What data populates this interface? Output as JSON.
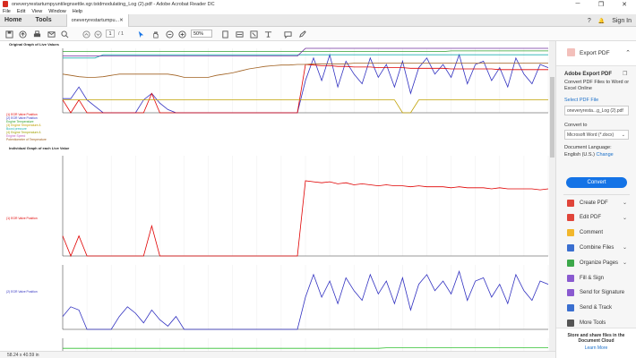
{
  "window": {
    "title": "oneveryrestartumpyuntilegnsettle.xgr.tstdmodulating_Log (2).pdf - Adobe Acrobat Reader DC",
    "minimize": "─",
    "maximize": "❐",
    "close": "✕"
  },
  "menu": [
    "File",
    "Edit",
    "View",
    "Window",
    "Help"
  ],
  "tabs": {
    "home": "Home",
    "tools": "Tools",
    "doc_tab": "oneveryrestartumpu...",
    "doc_tab_close": "✕",
    "help_icon": "?",
    "bell_icon": "🔔",
    "sign_in": "Sign In"
  },
  "toolbar": {
    "page_current": "1",
    "page_total": "/ 1",
    "zoom": "50%"
  },
  "document": {
    "heading1": "Original Graph of Live Values",
    "heading2": "Individual Graph of each Live Value",
    "legend1": [
      {
        "text": "(1) EGR Valve Position",
        "color": "#e00000"
      },
      {
        "text": "(2) EGR Valve Position",
        "color": "#3030c0"
      },
      {
        "text": "Engine Temperature",
        "color": "#30a030"
      },
      {
        "text": "(3) Engine Temperature A",
        "color": "#c0a000"
      },
      {
        "text": "Boost pressure",
        "color": "#20b0b0"
      },
      {
        "text": "(4) Engine Temperature A",
        "color": "#a0a000"
      },
      {
        "text": "Engine Speed",
        "color": "#c060c0"
      },
      {
        "text": "Potentiometer of Temperature",
        "color": "#a06020"
      }
    ],
    "label_red": "(1) EGR Valve Position",
    "label_blue": "(2) EGR Valve Position"
  },
  "status": {
    "size": "58.24 x 40.59 in"
  },
  "right_pane": {
    "header": "Export PDF",
    "section_title": "Adobe Export PDF",
    "desc": "Convert PDF Files to Word or Excel Online",
    "select_label": "Select PDF File",
    "file_value": "oneveryresta...g_Log (2).pdf",
    "convert_to": "Convert to",
    "format": "Microsoft Word (*.docx)",
    "lang_label": "Document Language:",
    "lang_value": "English (U.S.)",
    "change": "Change",
    "convert_btn": "Convert",
    "tools": [
      {
        "label": "Create PDF",
        "color": "#e0453a",
        "chev": "⌄"
      },
      {
        "label": "Edit PDF",
        "color": "#e0453a",
        "chev": "⌄"
      },
      {
        "label": "Comment",
        "color": "#f2b72c",
        "chev": ""
      },
      {
        "label": "Combine Files",
        "color": "#3a6fd0",
        "chev": "⌄"
      },
      {
        "label": "Organize Pages",
        "color": "#3ca84a",
        "chev": "⌄"
      },
      {
        "label": "Fill & Sign",
        "color": "#8a5ad0",
        "chev": ""
      },
      {
        "label": "Send for Signature",
        "color": "#8a5ad0",
        "chev": ""
      },
      {
        "label": "Send & Track",
        "color": "#3a6fd0",
        "chev": ""
      },
      {
        "label": "More Tools",
        "color": "#555555",
        "chev": ""
      }
    ],
    "foot_text": "Store and share files in the Document Cloud",
    "learn_more": "Learn More"
  },
  "chart_data": [
    {
      "type": "line",
      "title": "Original Graph of Live Values",
      "x": [
        0,
        1,
        2,
        3,
        4,
        5,
        6,
        7,
        8,
        9,
        10,
        11,
        12,
        13,
        14,
        15,
        16,
        17,
        18,
        19,
        20,
        21,
        22,
        23,
        24,
        25,
        26,
        27,
        28,
        29,
        30,
        31,
        32,
        33,
        34,
        35,
        36,
        37,
        38,
        39,
        40,
        41,
        42,
        43,
        44,
        45,
        46,
        47,
        48,
        49,
        50,
        51,
        52,
        53,
        54,
        55,
        56,
        57,
        58,
        59,
        60
      ],
      "series": [
        {
          "color": "#3030c0",
          "values": [
            22,
            22,
            40,
            20,
            10,
            0,
            0,
            0,
            0,
            0,
            20,
            30,
            15,
            5,
            0,
            0,
            0,
            0,
            0,
            0,
            0,
            0,
            0,
            0,
            0,
            0,
            0,
            0,
            0,
            0,
            50,
            85,
            50,
            90,
            40,
            80,
            60,
            45,
            85,
            55,
            75,
            40,
            80,
            30,
            70,
            85,
            60,
            75,
            55,
            90,
            45,
            75,
            80,
            50,
            70,
            40,
            85,
            60,
            45,
            75,
            70
          ]
        },
        {
          "color": "#e00000",
          "values": [
            20,
            0,
            20,
            0,
            0,
            0,
            0,
            0,
            0,
            0,
            0,
            30,
            0,
            0,
            0,
            0,
            0,
            0,
            0,
            0,
            0,
            0,
            0,
            0,
            0,
            0,
            0,
            0,
            0,
            0,
            75,
            74,
            73,
            73,
            72,
            72,
            71,
            71,
            71,
            70,
            70,
            70,
            70,
            69,
            69,
            69,
            69,
            69,
            68,
            68,
            68,
            68,
            68,
            68,
            67,
            67,
            67,
            67,
            67,
            67,
            67
          ]
        },
        {
          "color": "#a06020",
          "values": [
            60,
            58,
            56,
            55,
            55,
            56,
            58,
            60,
            60,
            60,
            60,
            60,
            60,
            60,
            58,
            55,
            55,
            55,
            55,
            58,
            60,
            62,
            65,
            68,
            70,
            72,
            73,
            74,
            74,
            75,
            75,
            76,
            76,
            76,
            76,
            76,
            77,
            77,
            77,
            77,
            77,
            77,
            77,
            77,
            77,
            77,
            77,
            77,
            77,
            77,
            77,
            77,
            77,
            77,
            77,
            77,
            77,
            77,
            77,
            77,
            77
          ]
        },
        {
          "color": "#20b0b0",
          "values": [
            85,
            85,
            85,
            85,
            85,
            90,
            90,
            90,
            90,
            90,
            90,
            90,
            90,
            90,
            90,
            90,
            90,
            90,
            90,
            90,
            90,
            90,
            90,
            90,
            90,
            90,
            90,
            90,
            90,
            90,
            90,
            90,
            90,
            90,
            90,
            90,
            90,
            90,
            90,
            90,
            90,
            90,
            90,
            90,
            90,
            90,
            90,
            90,
            90,
            90,
            90,
            90,
            90,
            90,
            90,
            90,
            90,
            90,
            90,
            90,
            90
          ]
        },
        {
          "color": "#30a030",
          "values": [
            95,
            95,
            95,
            95,
            95,
            95,
            95,
            95,
            95,
            95,
            95,
            95,
            95,
            95,
            95,
            95,
            95,
            95,
            95,
            95,
            95,
            95,
            95,
            95,
            95,
            95,
            95,
            95,
            95,
            95,
            95,
            95,
            95,
            95,
            95,
            95,
            95,
            95,
            95,
            95,
            95,
            95,
            95,
            95,
            95,
            95,
            95,
            95,
            96,
            96,
            96,
            96,
            96,
            96,
            96,
            96,
            96,
            96,
            96,
            96,
            96
          ]
        },
        {
          "color": "#c0a000",
          "values": [
            20,
            20,
            20,
            20,
            20,
            20,
            20,
            20,
            20,
            20,
            20,
            20,
            20,
            20,
            20,
            20,
            20,
            20,
            20,
            20,
            20,
            20,
            20,
            20,
            20,
            20,
            20,
            20,
            20,
            20,
            20,
            20,
            20,
            20,
            20,
            20,
            20,
            20,
            20,
            20,
            20,
            20,
            0,
            0,
            20,
            20,
            20,
            20,
            20,
            20,
            20,
            20,
            20,
            20,
            20,
            20,
            20,
            20,
            20,
            20,
            20
          ]
        },
        {
          "color": "#7030a0",
          "values": [
            88,
            88,
            88,
            88,
            88,
            88,
            88,
            88,
            88,
            88,
            88,
            88,
            88,
            88,
            88,
            88,
            88,
            88,
            88,
            88,
            88,
            88,
            88,
            88,
            88,
            88,
            88,
            88,
            88,
            88,
            100,
            100,
            100,
            100,
            100,
            100,
            100,
            100,
            100,
            100,
            100,
            100,
            100,
            100,
            100,
            100,
            100,
            100,
            100,
            100,
            100,
            100,
            100,
            100,
            100,
            100,
            100,
            100,
            100,
            100,
            100
          ]
        }
      ]
    },
    {
      "type": "line",
      "x": [
        0,
        1,
        2,
        3,
        4,
        5,
        6,
        7,
        8,
        9,
        10,
        11,
        12,
        13,
        14,
        15,
        16,
        17,
        18,
        19,
        20,
        21,
        22,
        23,
        24,
        25,
        26,
        27,
        28,
        29,
        30,
        31,
        32,
        33,
        34,
        35,
        36,
        37,
        38,
        39,
        40,
        41,
        42,
        43,
        44,
        45,
        46,
        47,
        48,
        49,
        50,
        51,
        52,
        53,
        54,
        55,
        56,
        57,
        58,
        59,
        60
      ],
      "series": [
        {
          "color": "#e00000",
          "values": [
            20,
            0,
            20,
            0,
            0,
            0,
            0,
            0,
            0,
            0,
            0,
            30,
            0,
            0,
            0,
            0,
            0,
            0,
            0,
            0,
            0,
            0,
            0,
            0,
            0,
            0,
            0,
            0,
            0,
            0,
            75,
            74,
            73,
            74,
            72,
            73,
            71,
            72,
            71,
            70,
            71,
            70,
            70,
            69,
            70,
            69,
            69,
            69,
            68,
            69,
            68,
            68,
            68,
            67,
            68,
            67,
            67,
            67,
            67,
            66,
            67
          ]
        }
      ],
      "ylim": [
        0,
        100
      ]
    },
    {
      "type": "line",
      "x": [
        0,
        1,
        2,
        3,
        4,
        5,
        6,
        7,
        8,
        9,
        10,
        11,
        12,
        13,
        14,
        15,
        16,
        17,
        18,
        19,
        20,
        21,
        22,
        23,
        24,
        25,
        26,
        27,
        28,
        29,
        30,
        31,
        32,
        33,
        34,
        35,
        36,
        37,
        38,
        39,
        40,
        41,
        42,
        43,
        44,
        45,
        46,
        47,
        48,
        49,
        50,
        51,
        52,
        53,
        54,
        55,
        56,
        57,
        58,
        59,
        60
      ],
      "series": [
        {
          "color": "#3030c0",
          "values": [
            20,
            35,
            30,
            0,
            0,
            0,
            0,
            20,
            35,
            25,
            10,
            30,
            15,
            5,
            20,
            0,
            0,
            0,
            0,
            0,
            0,
            0,
            0,
            0,
            0,
            0,
            0,
            0,
            0,
            0,
            50,
            85,
            50,
            75,
            40,
            80,
            60,
            45,
            85,
            55,
            75,
            40,
            80,
            30,
            70,
            85,
            60,
            75,
            55,
            90,
            45,
            75,
            80,
            50,
            70,
            40,
            85,
            60,
            45,
            75,
            70
          ]
        }
      ],
      "ylim": [
        0,
        100
      ]
    },
    {
      "type": "line",
      "x": [
        0,
        1,
        2,
        3,
        4,
        5,
        6,
        7,
        8,
        9,
        10,
        11,
        12,
        13,
        14,
        15,
        16,
        17,
        18,
        19,
        20,
        21,
        22,
        23,
        24,
        25,
        26,
        27,
        28,
        29,
        30,
        31,
        32,
        33,
        34,
        35,
        36,
        37,
        38,
        39,
        40,
        41,
        42,
        43,
        44,
        45,
        46,
        47,
        48,
        49,
        50,
        51,
        52,
        53,
        54,
        55,
        56,
        57,
        58,
        59,
        60
      ],
      "series": [
        {
          "color": "#30c030",
          "values": [
            60,
            60,
            60,
            60,
            60,
            60,
            60,
            60,
            60,
            60,
            60,
            60,
            60,
            60,
            60,
            60,
            60,
            60,
            60,
            60,
            60,
            60,
            60,
            60,
            60,
            60,
            60,
            60,
            60,
            60,
            60,
            60,
            60,
            60,
            60,
            60,
            60,
            60,
            60,
            60,
            62,
            62,
            62,
            62,
            62,
            62,
            62,
            62,
            62,
            62,
            62,
            62,
            62,
            62,
            62,
            62,
            62,
            62,
            62,
            62,
            62
          ]
        }
      ],
      "ylim": [
        0,
        100
      ]
    }
  ]
}
